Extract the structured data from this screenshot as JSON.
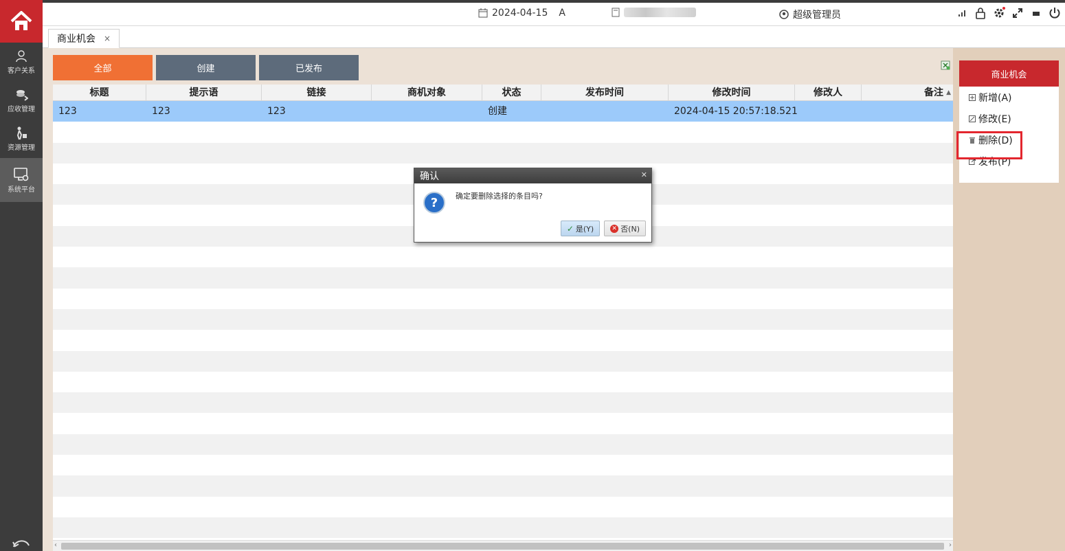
{
  "topbar": {
    "date": "2024-04-15",
    "date_suffix": "A",
    "user": "超级管理员"
  },
  "sidebar": {
    "items": [
      {
        "label": "客户关系",
        "icon": "users-icon"
      },
      {
        "label": "应收管理",
        "icon": "coins-icon"
      },
      {
        "label": "资源管理",
        "icon": "person-cart-icon"
      },
      {
        "label": "系统平台",
        "icon": "monitor-gear-icon",
        "active": true
      }
    ]
  },
  "tabs": [
    {
      "label": "商业机会",
      "close": "×"
    }
  ],
  "filters": [
    {
      "label": "全部",
      "active": true
    },
    {
      "label": "创建",
      "active": false
    },
    {
      "label": "已发布",
      "active": false
    }
  ],
  "grid": {
    "columns": [
      "标题",
      "提示语",
      "链接",
      "商机对象",
      "状态",
      "发布时间",
      "修改时间",
      "修改人",
      "备注"
    ],
    "rows": [
      [
        "123",
        "123",
        "123",
        "",
        "创建",
        "",
        "2024-04-15 20:57:18.521",
        "",
        ""
      ]
    ]
  },
  "panel": {
    "title": "商业机会",
    "actions": [
      {
        "label": "新增(A)",
        "icon": "add-icon"
      },
      {
        "label": "修改(E)",
        "icon": "edit-icon"
      },
      {
        "label": "删除(D)",
        "icon": "trash-icon"
      },
      {
        "label": "发布(P)",
        "icon": "publish-icon"
      }
    ]
  },
  "dialog": {
    "title": "确认",
    "message": "确定要删除选择的条目吗?",
    "yes": "是(Y)",
    "no": "否(N)"
  },
  "colors": {
    "brand_red": "#c8282d",
    "filter_active": "#f07034",
    "filter_inactive": "#5d6b7b",
    "selected_row": "#9ccafa",
    "highlight_box": "#e3262e"
  }
}
